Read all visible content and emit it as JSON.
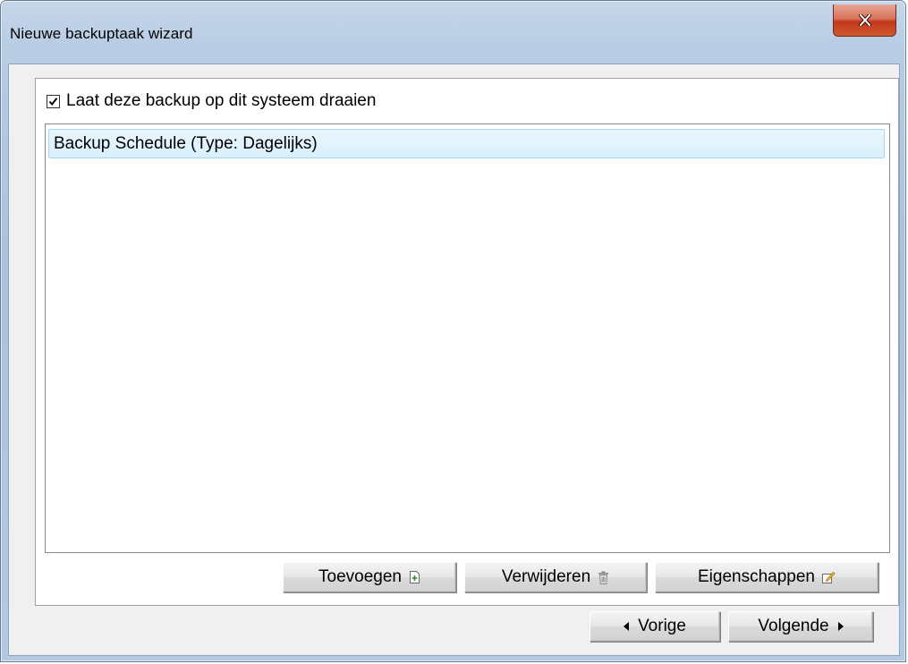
{
  "window": {
    "title": "Nieuwe backuptaak wizard",
    "close_icon": "close-x-icon"
  },
  "options": {
    "run_on_system_label": "Laat deze backup op dit systeem draaien",
    "run_on_system_checked": true
  },
  "schedule_list": {
    "items": [
      {
        "label": "Backup Schedule (Type: Dagelijks)",
        "selected": true
      }
    ]
  },
  "list_actions": {
    "add_label": "Toevoegen",
    "add_icon": "add-icon",
    "remove_label": "Verwijderen",
    "remove_icon": "trash-icon",
    "properties_label": "Eigenschappen",
    "properties_icon": "edit-icon"
  },
  "navigation": {
    "prev_label": "Vorige",
    "prev_icon": "arrow-left-icon",
    "next_label": "Volgende",
    "next_icon": "arrow-right-icon"
  },
  "colors": {
    "selection_bg": "#d9f0fc",
    "selection_border": "#a7d8f3",
    "close_button": "#c2381a",
    "dialog_bg": "#f0f0f0"
  }
}
